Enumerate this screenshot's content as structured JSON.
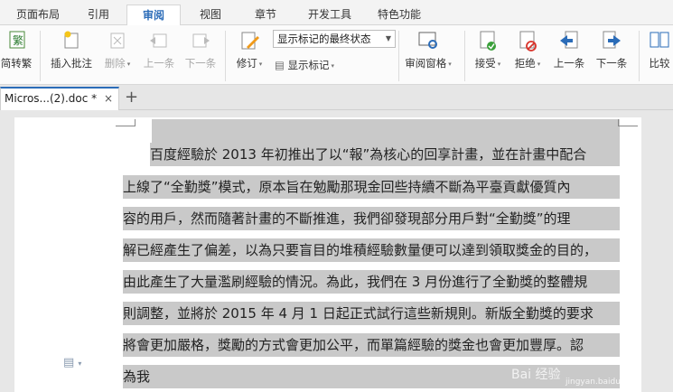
{
  "menu": {
    "tabs": [
      "页面布局",
      "引用",
      "审阅",
      "视图",
      "章节",
      "开发工具",
      "特色功能"
    ],
    "active_tab": "审阅"
  },
  "ribbon": {
    "trad_simplified_label": "简转繁",
    "insert_comment_label": "插入批注",
    "delete_label": "删除",
    "prev_comment_label": "上一条",
    "next_comment_label": "下一条",
    "track_changes_label": "修订",
    "display_mode_value": "显示标记的最终状态",
    "show_markup_label": "显示标记",
    "review_pane_label": "审阅窗格",
    "accept_label": "接受",
    "reject_label": "拒绝",
    "prev_change_label": "上一条",
    "next_change_label": "下一条",
    "compare_label": "比较"
  },
  "tabs": {
    "doc_title": "Micros...(2).doc *",
    "close_symbol": "×",
    "new_tab_symbol": "+"
  },
  "document": {
    "lines": [
      "百度經驗於 2013 年初推出了以“報”為核心的回享計畫，並在計畫中配合",
      "上線了“全勤獎”模式，原本旨在勉勵那現金回些持續不斷為平臺貢獻優質內",
      "容的用戶，然而隨著計畫的不斷推進，我們卻發現部分用戶對“全勤獎”的理",
      "解已經產生了偏差，以為只要盲目的堆積經驗數量便可以達到領取獎金的目的，",
      "由此產生了大量濫刷經驗的情況。為此，我們在 3 月份進行了全勤獎的整體規",
      "則調整，並將於 2015 年 4 月 1 日起正式試行這些新規則。新版全勤獎的要求",
      "將會更加嚴格，獎勵的方式會更加公平，而單篇經驗的獎金也會更加豐厚。認",
      "為我"
    ]
  },
  "watermark": {
    "brand": "Bai 经验",
    "url": "jingyan.baidu.com"
  },
  "colors": {
    "accent": "#2b6cb8",
    "selection": "#c9c9c9"
  }
}
